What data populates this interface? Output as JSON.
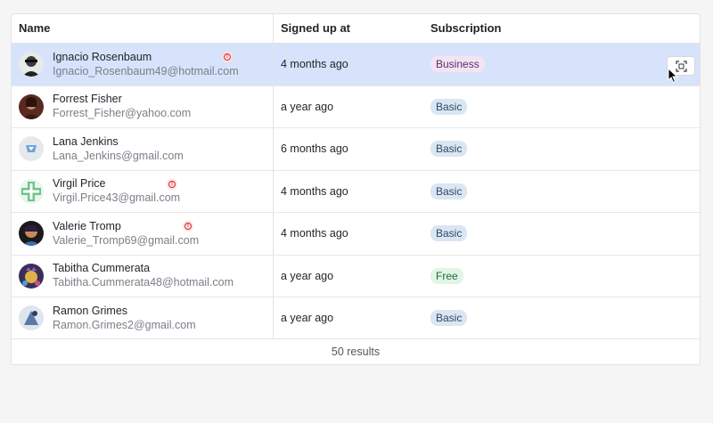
{
  "table": {
    "headers": {
      "name": "Name",
      "signed_up": "Signed up at",
      "subscription": "Subscription"
    },
    "rows": [
      {
        "name": "Ignacio Rosenbaum",
        "email": "Ignacio_Rosenbaum49@hotmail.com",
        "signed_up": "4 months ago",
        "subscription": "Business",
        "alert": true,
        "selected": true
      },
      {
        "name": "Forrest Fisher",
        "email": "Forrest_Fisher@yahoo.com",
        "signed_up": "a year ago",
        "subscription": "Basic",
        "alert": false,
        "selected": false
      },
      {
        "name": "Lana Jenkins",
        "email": "Lana_Jenkins@gmail.com",
        "signed_up": "6 months ago",
        "subscription": "Basic",
        "alert": false,
        "selected": false
      },
      {
        "name": "Virgil Price",
        "email": "Virgil.Price43@gmail.com",
        "signed_up": "4 months ago",
        "subscription": "Basic",
        "alert": true,
        "selected": false
      },
      {
        "name": "Valerie Tromp",
        "email": "Valerie_Tromp69@gmail.com",
        "signed_up": "4 months ago",
        "subscription": "Basic",
        "alert": true,
        "selected": false
      },
      {
        "name": "Tabitha Cummerata",
        "email": "Tabitha.Cummerata48@hotmail.com",
        "signed_up": "a year ago",
        "subscription": "Free",
        "alert": false,
        "selected": false
      },
      {
        "name": "Ramon Grimes",
        "email": "Ramon.Grimes2@gmail.com",
        "signed_up": "a year ago",
        "subscription": "Basic",
        "alert": false,
        "selected": false
      }
    ],
    "footer": "50 results"
  },
  "icons": {
    "alert": "alert-circle-icon",
    "row_action": "scan-icon",
    "cursor": "mouse-pointer-icon"
  },
  "colors": {
    "selected_row": "#d7e3fb",
    "badge_basic": "#dbe6f3",
    "badge_business": "#f3e4f3",
    "badge_free": "#e1f4e6",
    "alert": "#d72d2d"
  }
}
